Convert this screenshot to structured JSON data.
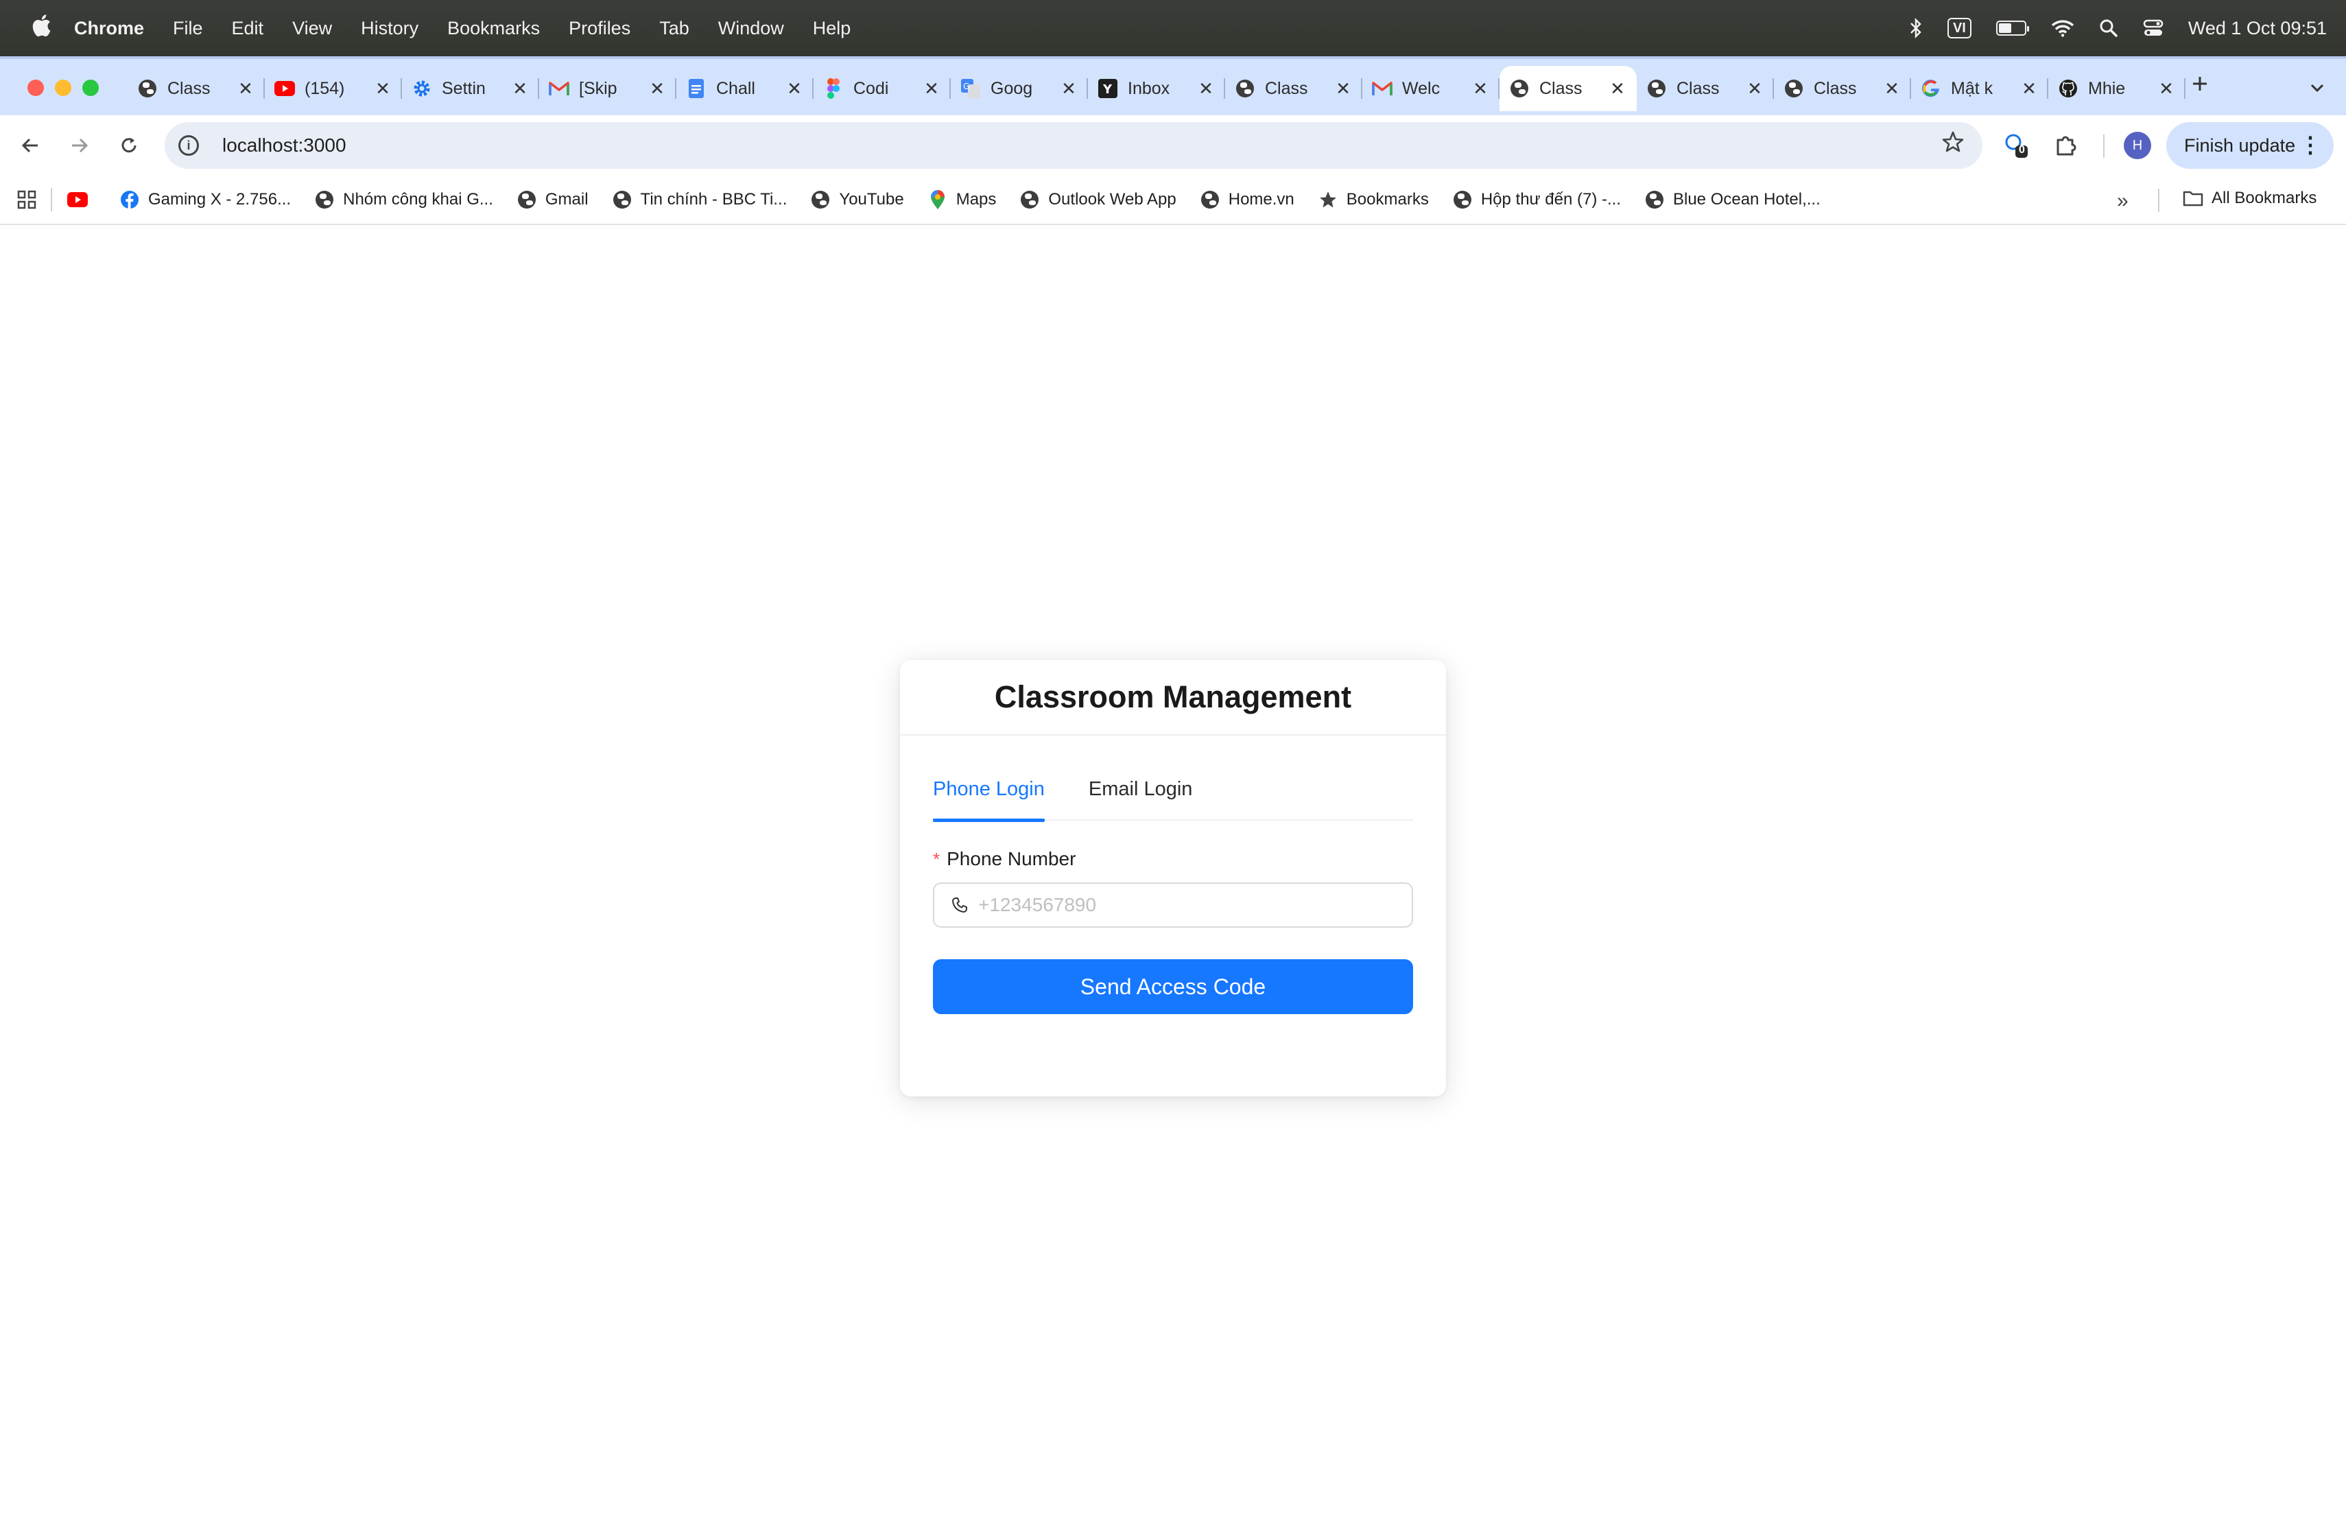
{
  "menubar": {
    "app": "Chrome",
    "items": [
      "File",
      "Edit",
      "View",
      "History",
      "Bookmarks",
      "Profiles",
      "Tab",
      "Window",
      "Help"
    ],
    "input_source": "VI",
    "battery_level": 0.5,
    "datetime": "Wed 1 Oct  09:51"
  },
  "tabs": [
    {
      "label": "Class",
      "icon": "globe-icon"
    },
    {
      "label": "(154)",
      "icon": "youtube-icon"
    },
    {
      "label": "Settin",
      "icon": "settings-gear-icon"
    },
    {
      "label": "[Skip",
      "icon": "gmail-icon"
    },
    {
      "label": "Chall",
      "icon": "google-docs-icon"
    },
    {
      "label": "Codi",
      "icon": "figma-icon"
    },
    {
      "label": "Goog",
      "icon": "google-translate-icon"
    },
    {
      "label": "Inbox",
      "icon": "yahoo-icon"
    },
    {
      "label": "Class",
      "icon": "globe-icon"
    },
    {
      "label": "Welc",
      "icon": "gmail-icon"
    },
    {
      "label": "Class",
      "icon": "globe-icon",
      "active": true
    },
    {
      "label": "Class",
      "icon": "globe-icon"
    },
    {
      "label": "Class",
      "icon": "globe-icon"
    },
    {
      "label": "Mật k",
      "icon": "google-icon"
    },
    {
      "label": "Mhie",
      "icon": "github-icon"
    }
  ],
  "toolbar": {
    "url": "localhost:3000",
    "extension_badge": "0",
    "profile_initial": "H",
    "finish_update": "Finish update"
  },
  "bookmarks": {
    "items": [
      {
        "label": "",
        "icon": "youtube-icon"
      },
      {
        "label": "Gaming X - 2.756...",
        "icon": "facebook-icon"
      },
      {
        "label": "Nhóm công khai G...",
        "icon": "globe-icon"
      },
      {
        "label": "Gmail",
        "icon": "globe-icon"
      },
      {
        "label": "Tin chính - BBC Ti...",
        "icon": "globe-icon"
      },
      {
        "label": "YouTube",
        "icon": "globe-icon"
      },
      {
        "label": "Maps",
        "icon": "maps-pin-icon"
      },
      {
        "label": "Outlook Web App",
        "icon": "globe-icon"
      },
      {
        "label": "Home.vn",
        "icon": "globe-icon"
      },
      {
        "label": "Bookmarks",
        "icon": "star-icon"
      },
      {
        "label": "Hộp thư đến (7) -...",
        "icon": "globe-icon"
      },
      {
        "label": "Blue Ocean Hotel,...",
        "icon": "globe-icon"
      }
    ],
    "all_bookmarks": "All Bookmarks"
  },
  "login": {
    "title": "Classroom Management",
    "tabs": [
      "Phone Login",
      "Email Login"
    ],
    "active_tab": "Phone Login",
    "field_label": "Phone Number",
    "required_mark": "*",
    "phone_value": "",
    "phone_placeholder": "+1234567890",
    "submit_label": "Send Access Code"
  },
  "colors": {
    "primary": "#1677ff",
    "required": "#ff4d4f",
    "tabstrip": "#d3e3fd"
  }
}
